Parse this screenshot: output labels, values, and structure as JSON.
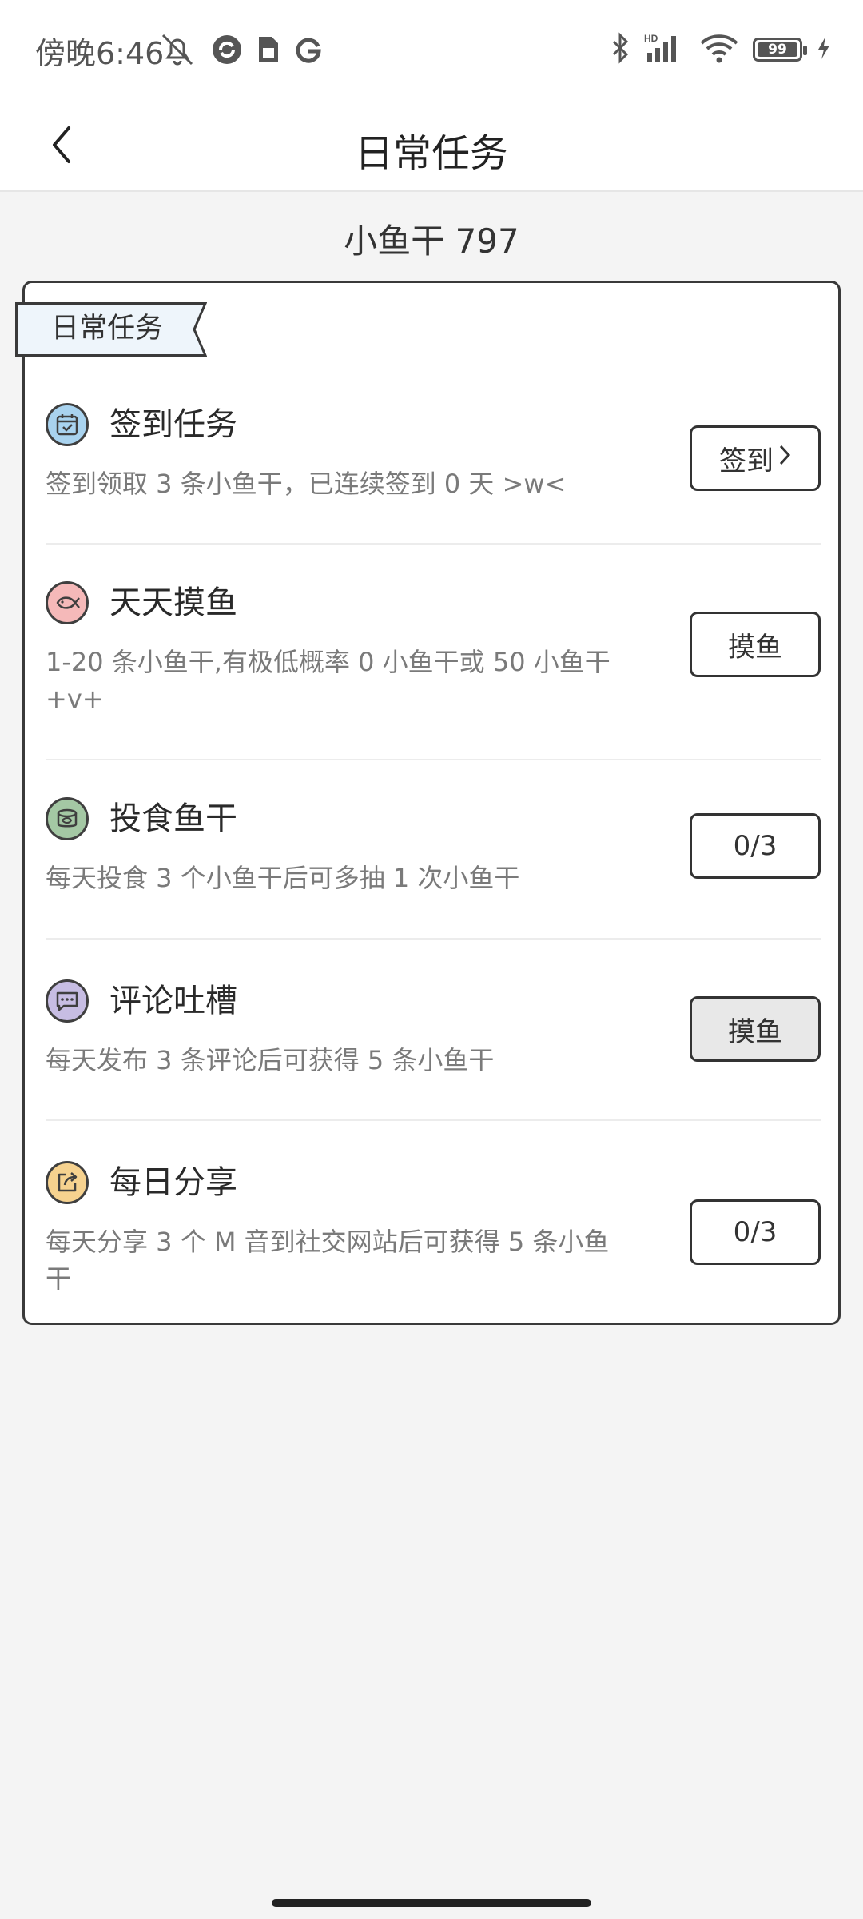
{
  "status_bar": {
    "time": "傍晚6:46",
    "battery": "99"
  },
  "header": {
    "title": "日常任务"
  },
  "summary": {
    "fish_label": "小鱼干 797"
  },
  "card": {
    "ribbon_label": "日常任务",
    "tasks": [
      {
        "icon": "calendar-icon",
        "icon_color": "#a9d3ef",
        "title": "签到任务",
        "desc": "签到领取 3 条小鱼干，已连续签到 0 天 >w<",
        "button": "签到",
        "button_icon": "chevron-right-icon"
      },
      {
        "icon": "fish-icon",
        "icon_color": "#f5b9b9",
        "title": "天天摸鱼",
        "desc": "1-20 条小鱼干,有极低概率 0 小鱼干或 50 小鱼干 +v+",
        "button": "摸鱼"
      },
      {
        "icon": "can-icon",
        "icon_color": "#a4c8a4",
        "title": "投食鱼干",
        "desc": "每天投食 3 个小鱼干后可多抽 1 次小鱼干",
        "button": "0/3"
      },
      {
        "icon": "comment-icon",
        "icon_color": "#c7bde3",
        "title": "评论吐槽",
        "desc": "每天发布 3 条评论后可获得 5 条小鱼干",
        "button": "摸鱼"
      },
      {
        "icon": "share-icon",
        "icon_color": "#f6d28f",
        "title": "每日分享",
        "desc": "每天分享 3 个 M 音到社交网站后可获得 5 条小鱼干",
        "button": "0/3"
      }
    ]
  }
}
